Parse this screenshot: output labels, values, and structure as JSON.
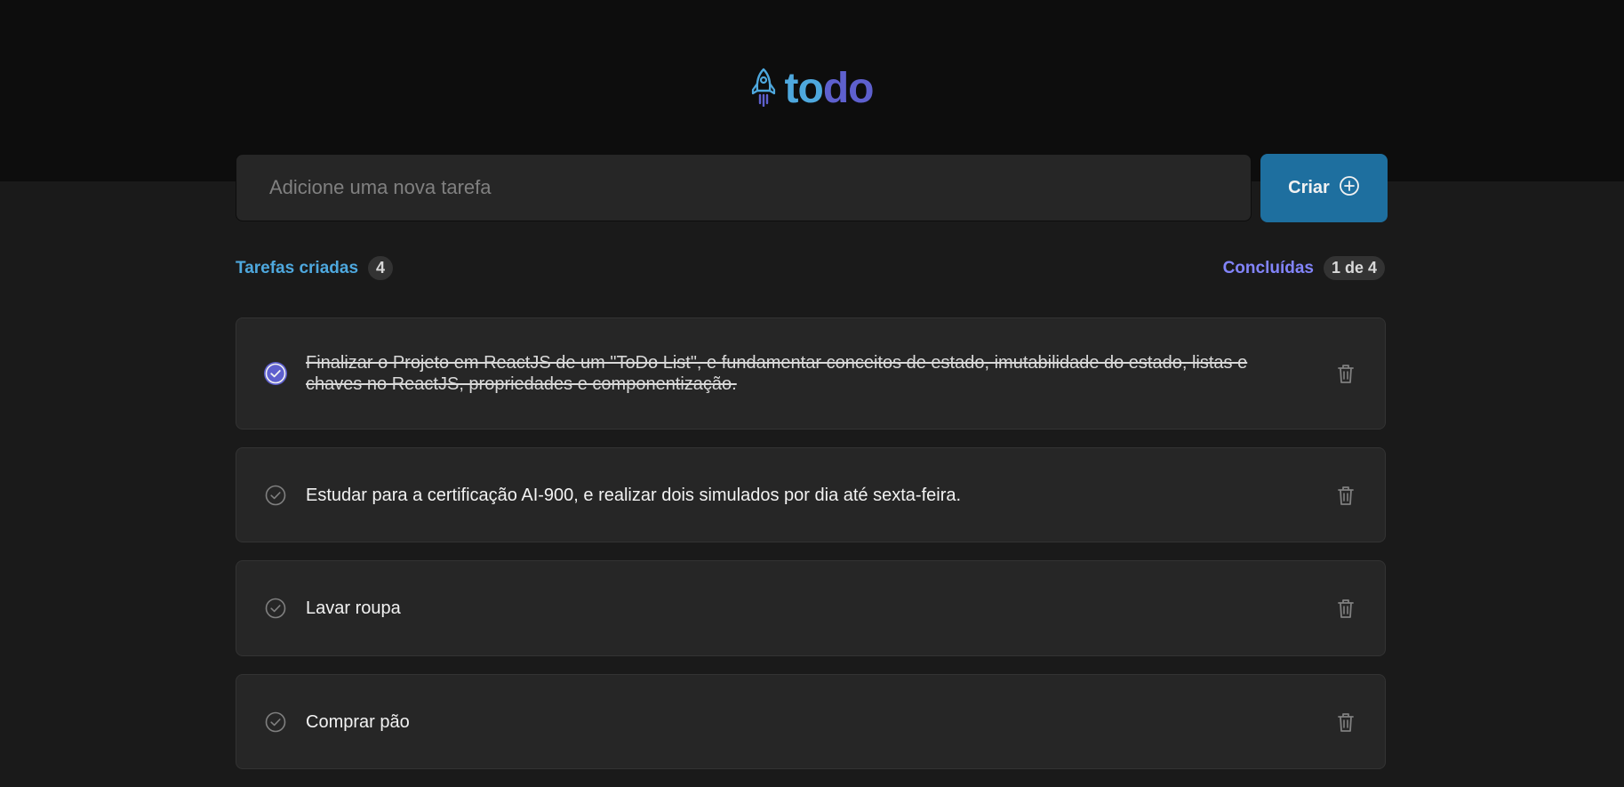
{
  "app": {
    "logo_part1": "to",
    "logo_part2": "do",
    "logo_icon": "rocket-icon"
  },
  "new_task": {
    "placeholder": "Adicione uma nova tarefa",
    "value": "",
    "create_label": "Criar",
    "create_icon": "plus-circle-icon"
  },
  "summary": {
    "created_label": "Tarefas criadas",
    "created_count": "4",
    "done_label": "Concluídas",
    "done_count": "1 de 4"
  },
  "tasks": [
    {
      "text": "Finalizar o Projeto em ReactJS de um \"ToDo List\", e fundamentar conceitos de estado, imutabilidade do estado, listas e chaves no ReactJS, propriedades e componentização.",
      "completed": true
    },
    {
      "text": "Estudar para a certificação AI-900, e realizar dois simulados por dia até sexta-feira.",
      "completed": false
    },
    {
      "text": "Lavar roupa",
      "completed": false
    },
    {
      "text": "Comprar pão",
      "completed": false
    }
  ],
  "colors": {
    "blue": "#4ea8de",
    "purple": "#5e60ce",
    "purple_light": "#8284fa",
    "button": "#1e6f9f",
    "header_bg": "#0d0d0d",
    "page_bg": "#1a1a1a",
    "card_bg": "#262626"
  }
}
